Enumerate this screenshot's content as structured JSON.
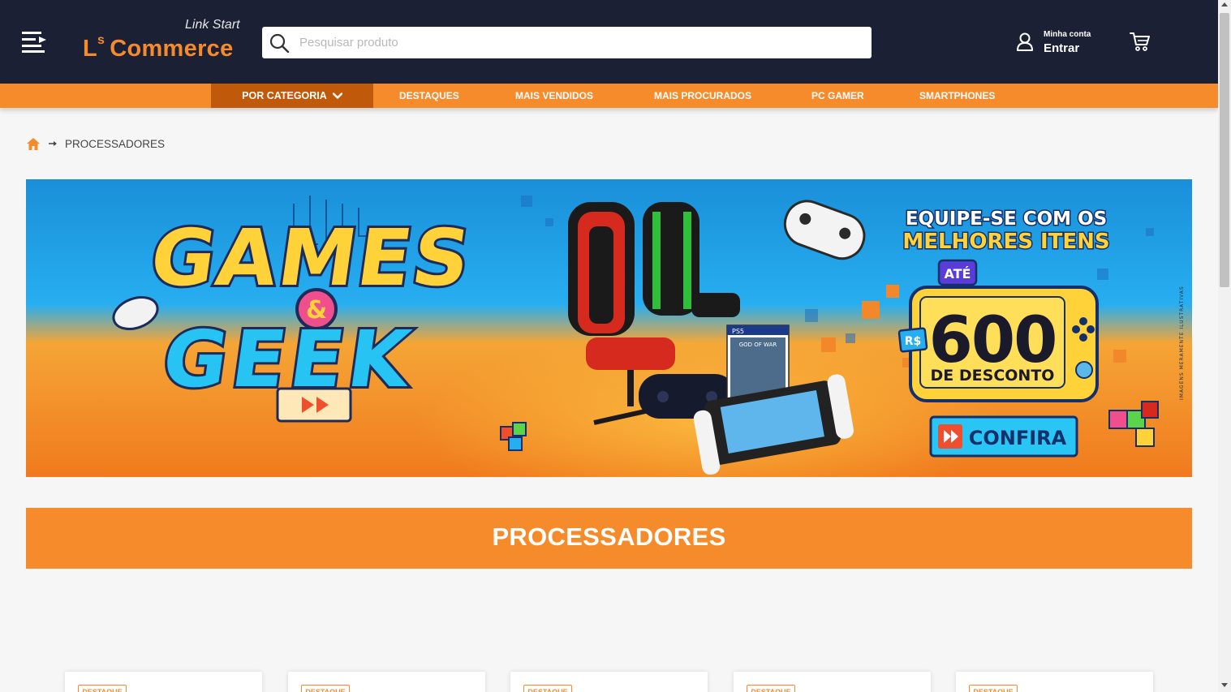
{
  "header": {
    "logo_tagline": "Link Start",
    "logo_superscript": "s",
    "logo_prefix": "L",
    "logo_name": "Commerce",
    "search_placeholder": "Pesquisar produto",
    "account_small": "Minha conta",
    "account_big": "Entrar",
    "colors": {
      "bg": "#1c2035",
      "brand": "#f68b2c"
    },
    "icons": [
      "menu-icon",
      "search-icon",
      "user-icon",
      "cart-icon"
    ]
  },
  "nav": {
    "category_label": "POR CATEGORIA",
    "items": [
      {
        "label": "DESTAQUES"
      },
      {
        "label": "MAIS VENDIDOS"
      },
      {
        "label": "MAIS PROCURADOS"
      },
      {
        "label": "PC GAMER"
      },
      {
        "label": "SMARTPHONES"
      }
    ]
  },
  "breadcrumb": {
    "current": "PROCESSADORES"
  },
  "banner": {
    "title_line1": "GAMES",
    "title_amp": "&",
    "title_line2": "GEEK",
    "headline_line1": "EQUIPE-SE COM OS",
    "headline_line2": "MELHORES ITENS",
    "ate": "ATÉ",
    "currency": "R$",
    "amount": "600",
    "discount": "DE DESCONTO",
    "cta": "CONFIRA",
    "disclaimer": "IMAGENS MERAMENTE ILUSTRATIVAS",
    "game_box_label": "GOD OF WAR",
    "ps5_label": "PS5"
  },
  "section": {
    "title": "PROCESSADORES"
  },
  "cards": [
    {
      "badge": "DESTAQUE"
    },
    {
      "badge": "DESTAQUE"
    },
    {
      "badge": "DESTAQUE"
    },
    {
      "badge": "DESTAQUE"
    },
    {
      "badge": "DESTAQUE"
    }
  ]
}
